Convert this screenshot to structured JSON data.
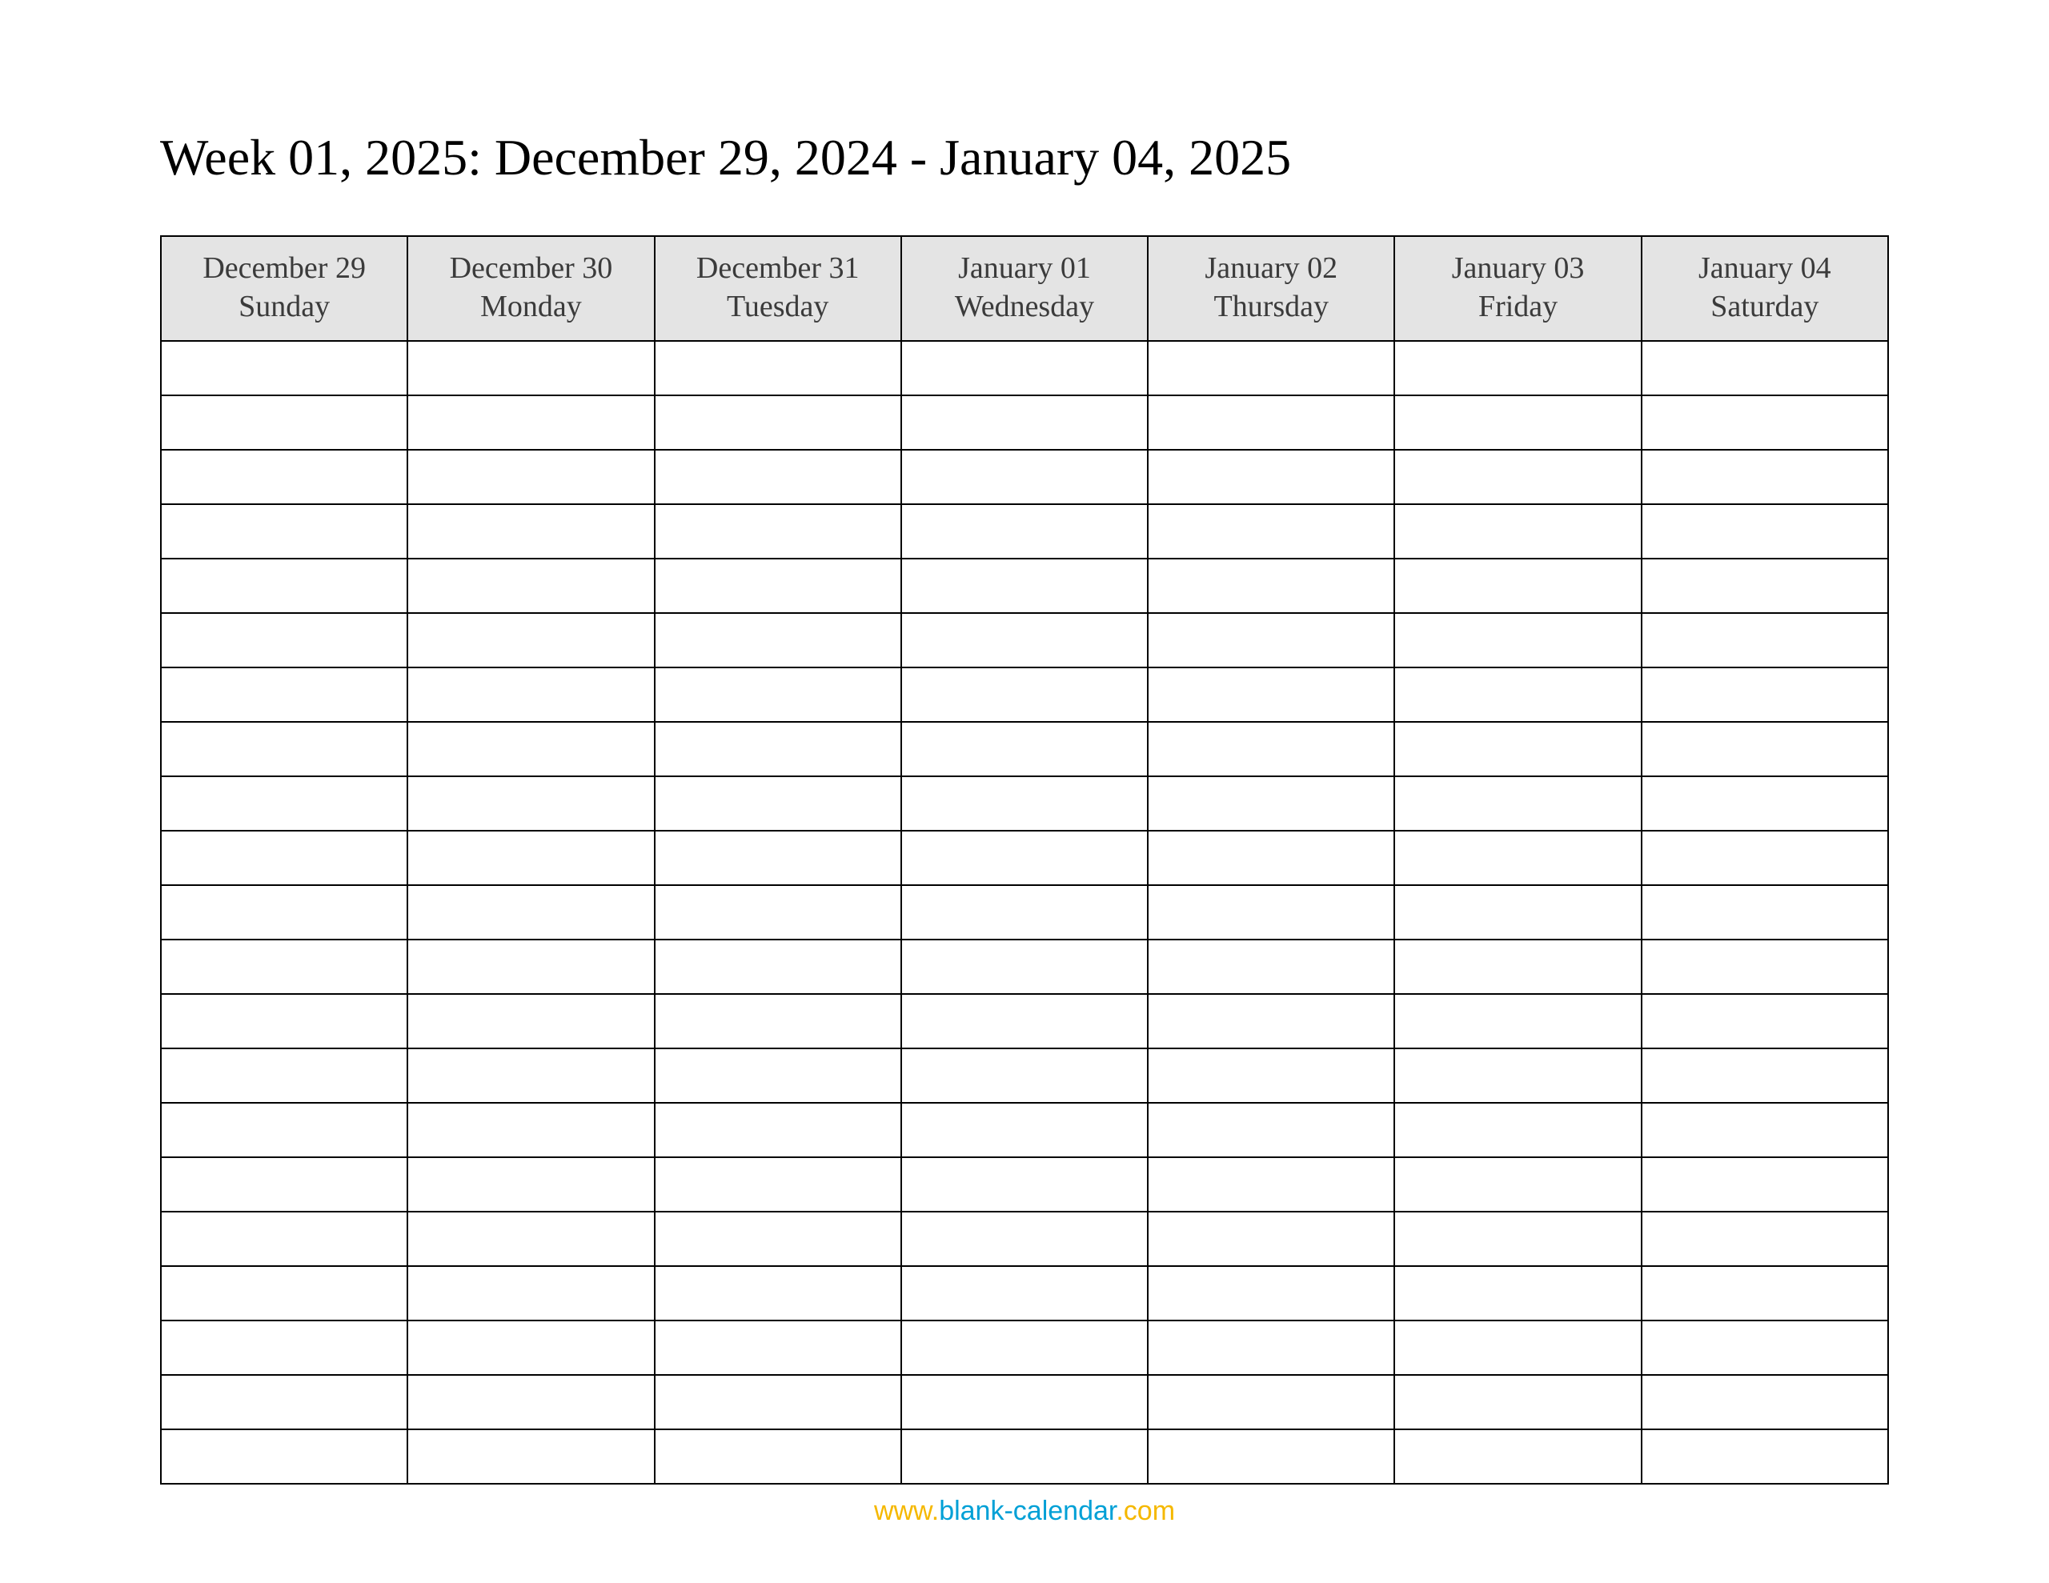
{
  "title": "Week 01, 2025: December 29, 2024 - January 04, 2025",
  "columns": [
    {
      "date": "December 29",
      "day": "Sunday"
    },
    {
      "date": "December 30",
      "day": "Monday"
    },
    {
      "date": "December 31",
      "day": "Tuesday"
    },
    {
      "date": "January 01",
      "day": "Wednesday"
    },
    {
      "date": "January 02",
      "day": "Thursday"
    },
    {
      "date": "January 03",
      "day": "Friday"
    },
    {
      "date": "January 04",
      "day": "Saturday"
    }
  ],
  "body_row_count": 21,
  "footer": {
    "www": "www.",
    "brand": "blank-calendar",
    "dot_com": ".com"
  }
}
